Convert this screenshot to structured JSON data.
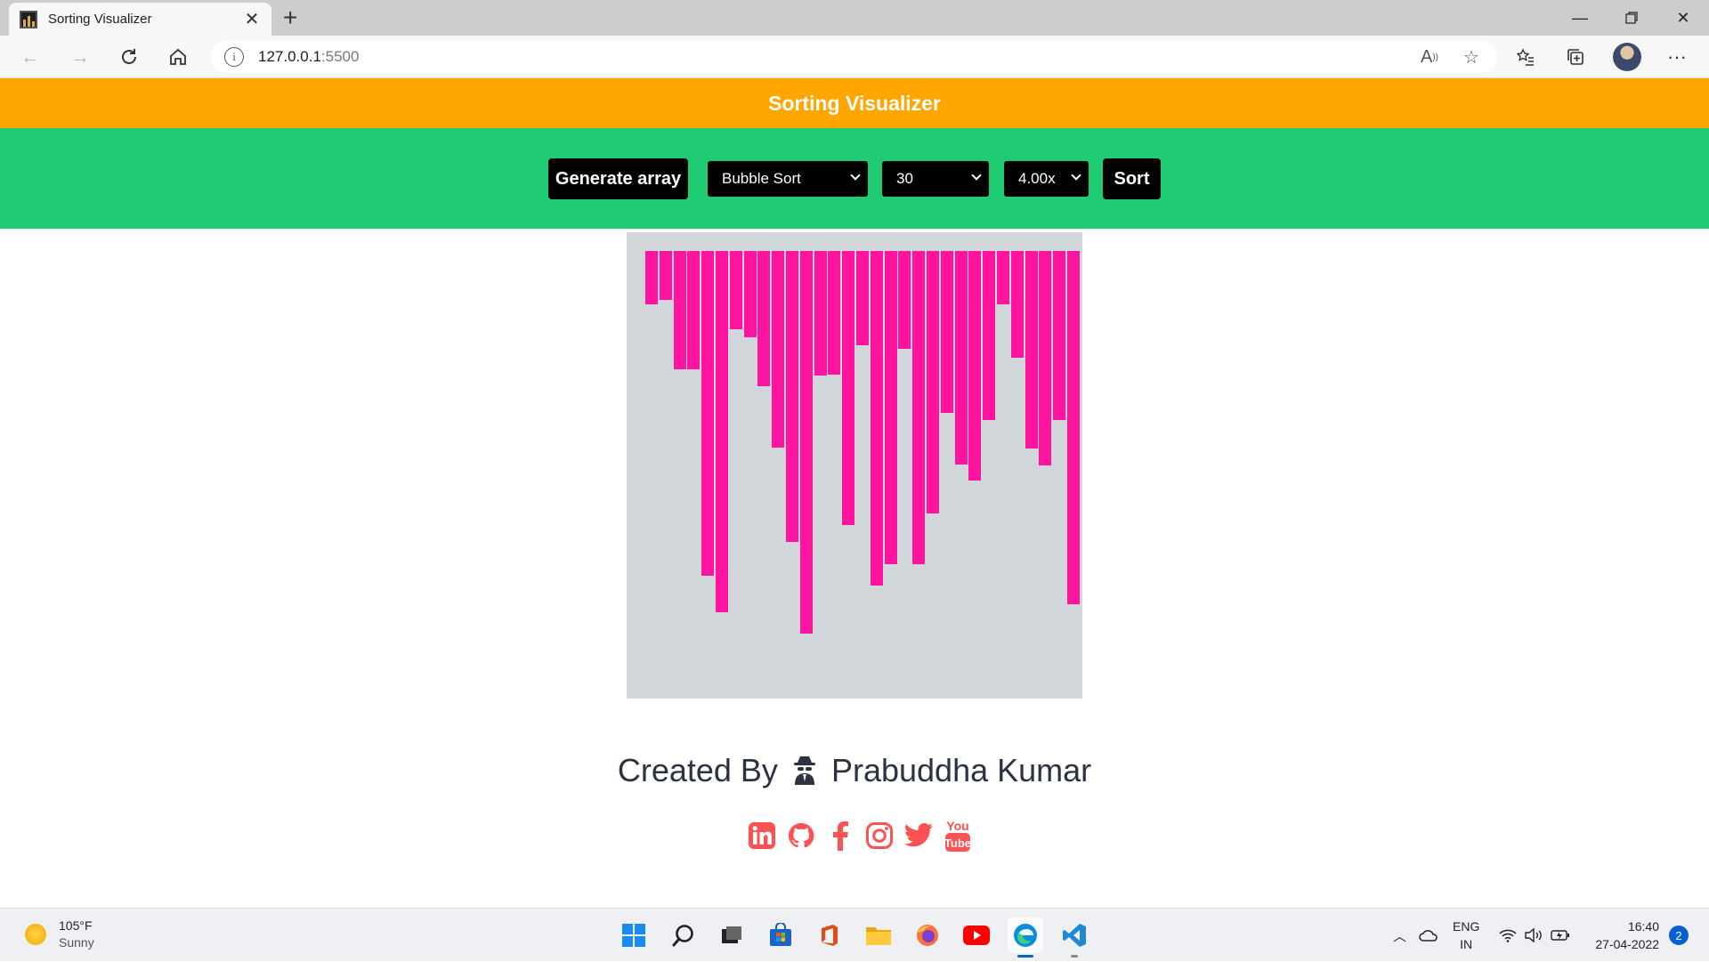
{
  "browser": {
    "tab_title": "Sorting Visualizer",
    "url_host": "127.0.0.1",
    "url_port": ":5500"
  },
  "page": {
    "title": "Sorting Visualizer",
    "generate_label": "Generate array",
    "algorithm_selected": "Bubble Sort",
    "size_selected": "30",
    "speed_selected": "4.00x",
    "sort_label": "Sort",
    "bar_color": "#ff149f",
    "bar_values": [
      60,
      55,
      133,
      133,
      365,
      406,
      88,
      97,
      152,
      221,
      327,
      430,
      140,
      139,
      308,
      106,
      376,
      352,
      110,
      352,
      295,
      182,
      240,
      258,
      190,
      60,
      120,
      222,
      241,
      190,
      397
    ],
    "credit_prefix": "Created By",
    "credit_name": "Prabuddha Kumar",
    "social_icons": [
      "linkedin-icon",
      "github-icon",
      "facebook-icon",
      "instagram-icon",
      "twitter-icon",
      "youtube-icon"
    ]
  },
  "taskbar": {
    "temperature": "105°F",
    "condition": "Sunny",
    "lang_top": "ENG",
    "lang_bottom": "IN",
    "time": "16:40",
    "date": "27-04-2022",
    "notification_count": "2"
  }
}
